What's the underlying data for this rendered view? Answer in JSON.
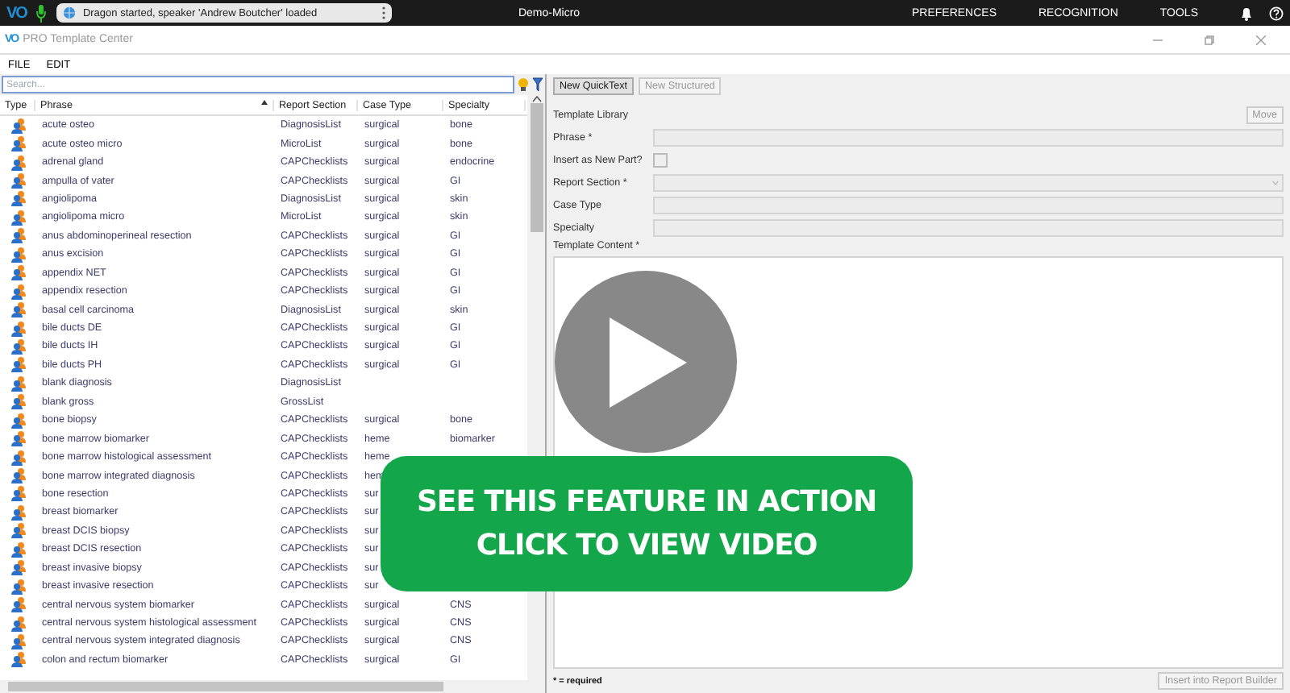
{
  "top_bar": {
    "logo": "VO",
    "status": "Dragon started, speaker 'Andrew Boutcher' loaded",
    "profile": "Demo-Micro",
    "menu": [
      "PREFERENCES",
      "RECOGNITION",
      "TOOLS"
    ]
  },
  "window": {
    "logo": "VO",
    "title": "PRO Template Center"
  },
  "menu_bar": [
    "FILE",
    "EDIT"
  ],
  "search": {
    "placeholder": "Search..."
  },
  "table": {
    "columns": [
      {
        "label": "Type",
        "sorted": false
      },
      {
        "label": "Phrase",
        "sorted": true
      },
      {
        "label": "Report Section",
        "sorted": false
      },
      {
        "label": "Case Type",
        "sorted": false
      },
      {
        "label": "Specialty",
        "sorted": false
      }
    ],
    "rows": [
      [
        "",
        "acute osteo",
        "DiagnosisList",
        "surgical",
        "bone"
      ],
      [
        "",
        "acute osteo micro",
        "MicroList",
        "surgical",
        "bone"
      ],
      [
        "",
        "adrenal gland",
        "CAPChecklists",
        "surgical",
        "endocrine"
      ],
      [
        "",
        "ampulla of vater",
        "CAPChecklists",
        "surgical",
        "GI"
      ],
      [
        "",
        "angiolipoma",
        "DiagnosisList",
        "surgical",
        "skin"
      ],
      [
        "",
        "angiolipoma micro",
        "MicroList",
        "surgical",
        "skin"
      ],
      [
        "",
        "anus abdominoperineal resection",
        "CAPChecklists",
        "surgical",
        "GI"
      ],
      [
        "",
        "anus excision",
        "CAPChecklists",
        "surgical",
        "GI"
      ],
      [
        "",
        "appendix NET",
        "CAPChecklists",
        "surgical",
        "GI"
      ],
      [
        "",
        "appendix resection",
        "CAPChecklists",
        "surgical",
        "GI"
      ],
      [
        "",
        "basal cell carcinoma",
        "DiagnosisList",
        "surgical",
        "skin"
      ],
      [
        "",
        "bile ducts DE",
        "CAPChecklists",
        "surgical",
        "GI"
      ],
      [
        "",
        "bile ducts IH",
        "CAPChecklists",
        "surgical",
        "GI"
      ],
      [
        "",
        "bile ducts PH",
        "CAPChecklists",
        "surgical",
        "GI"
      ],
      [
        "",
        "blank diagnosis",
        "DiagnosisList"
      ],
      [
        "",
        "blank gross",
        "GrossList"
      ],
      [
        "",
        "bone biopsy",
        "CAPChecklists",
        "surgical",
        "bone"
      ],
      [
        "",
        "bone marrow biomarker",
        "CAPChecklists",
        "heme",
        "biomarker"
      ],
      [
        "",
        "bone marrow histological assessment",
        "CAPChecklists",
        "heme"
      ],
      [
        "",
        "bone marrow integrated diagnosis",
        "CAPChecklists",
        "hem"
      ],
      [
        "",
        "bone resection",
        "CAPChecklists",
        "sur"
      ],
      [
        "",
        "breast biomarker",
        "CAPChecklists",
        "sur"
      ],
      [
        "",
        "breast DCIS biopsy",
        "CAPChecklists",
        "sur"
      ],
      [
        "",
        "breast DCIS resection",
        "CAPChecklists",
        "sur"
      ],
      [
        "",
        "breast invasive biopsy",
        "CAPChecklists",
        "sur"
      ],
      [
        "",
        "breast invasive resection",
        "CAPChecklists",
        "sur"
      ],
      [
        "",
        "central nervous system biomarker",
        "CAPChecklists",
        "surgical",
        "CNS"
      ],
      [
        "",
        "central nervous system histological assessment",
        "CAPChecklists",
        "surgical",
        "CNS"
      ],
      [
        "",
        "central nervous system integrated diagnosis",
        "CAPChecklists",
        "surgical",
        "CNS"
      ],
      [
        "",
        "colon and rectum biomarker",
        "CAPChecklists",
        "surgical",
        "GI"
      ]
    ]
  },
  "editor": {
    "buttons": [
      {
        "label": "New QuickText",
        "disabled": false
      },
      {
        "label": "New Structured",
        "disabled": true
      }
    ],
    "library_label": "Template Library",
    "move_button": {
      "label": "Move",
      "disabled": true
    },
    "fields": [
      {
        "kind": "text",
        "label": "Phrase *"
      },
      {
        "kind": "checkbox",
        "label": "Insert as New Part?",
        "checked": false
      },
      {
        "kind": "select",
        "label": "Report Section *"
      },
      {
        "kind": "text",
        "label": "Case Type"
      },
      {
        "kind": "text",
        "label": "Specialty"
      }
    ],
    "content_label": "Template Content *",
    "required_note": "* = required",
    "insert_button": {
      "label": "Insert into Report Builder",
      "disabled": true
    }
  },
  "video_banner": {
    "lines": [
      "SEE THIS FEATURE IN ACTION",
      "CLICK TO VIEW VIDEO"
    ]
  }
}
